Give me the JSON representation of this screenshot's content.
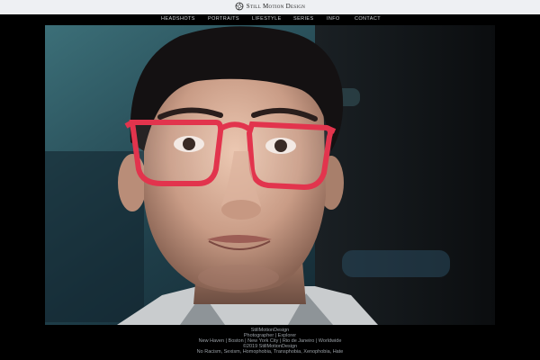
{
  "header": {
    "logo_text": "Still Motion Design"
  },
  "nav": {
    "items": [
      {
        "label": "Headshots"
      },
      {
        "label": "Portraits"
      },
      {
        "label": "Lifestyle"
      },
      {
        "label": "Series"
      },
      {
        "label": "Info"
      },
      {
        "label": "Contact"
      }
    ]
  },
  "footer": {
    "line1": "StillMotionDesign",
    "line2": "Photographer | Explorer",
    "line3": "New Haven | Boston | New York City | Rio de Janeiro | Worldwide",
    "line4": "©2019 StillMotionDesign",
    "line5": "No Racism, Sexism, Homophobia, Transphobia, Xenophobia, Hate"
  },
  "colors": {
    "glasses": "#e2344d",
    "topbar": "#eef0f3",
    "background": "#000000"
  }
}
